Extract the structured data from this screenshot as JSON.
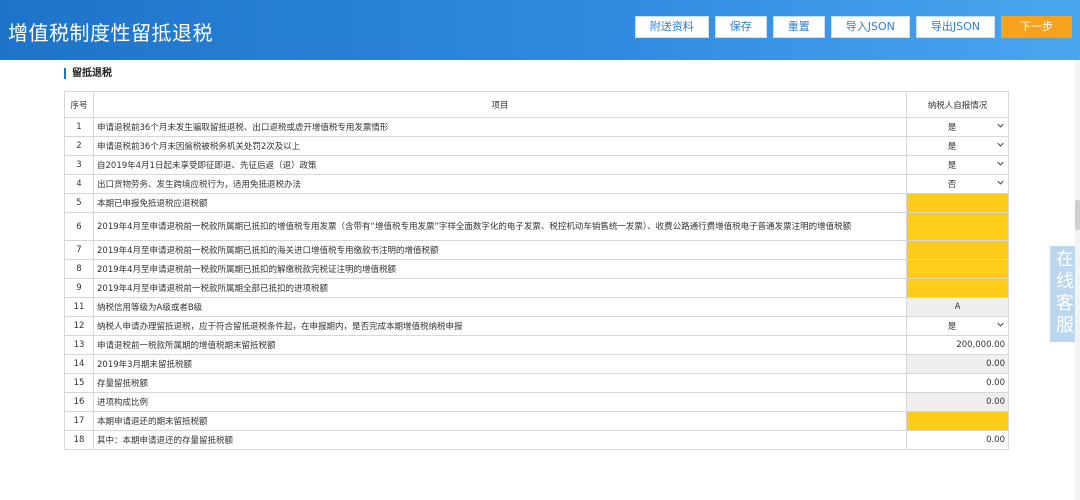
{
  "header": {
    "title": "增值税制度性留抵退税"
  },
  "toolbar": {
    "attachments_label": "附送资料",
    "save_label": "保存",
    "reset_label": "重置",
    "import_json_label": "导入JSON",
    "export_json_label": "导出JSON",
    "next_label": "下一步"
  },
  "colors": {
    "header_blue": "#1e73c8",
    "next_orange": "#f7a21c",
    "required_yellow": "#ffcc1a"
  },
  "section": {
    "title": "留抵退税"
  },
  "table": {
    "headers": {
      "no": "序号",
      "item": "项目",
      "value": "纳税人自报情况"
    },
    "rows": [
      {
        "no": "1",
        "item": "申请退税前36个月未发生骗取留抵退税、出口退税或虚开增值税专用发票情形",
        "value": "是",
        "type": "select"
      },
      {
        "no": "2",
        "item": "申请退税前36个月未因偷税被税务机关处罚2次及以上",
        "value": "是",
        "type": "select"
      },
      {
        "no": "3",
        "item": "自2019年4月1日起未享受即征即退、先征后返（退）政策",
        "value": "是",
        "type": "select"
      },
      {
        "no": "4",
        "item": "出口货物劳务、发生跨境应税行为，适用免抵退税办法",
        "value": "否",
        "type": "select"
      },
      {
        "no": "5",
        "item": "本期已申报免抵退税应退税额",
        "value": "",
        "type": "yellow"
      },
      {
        "no": "6",
        "item": "2019年4月至申请退税前一税款所属期已抵扣的增值税专用发票（含带有“增值税专用发票”字样全面数字化的电子发票、税控机动车销售统一发票）、收费公路通行费增值税电子普通发票注明的增值税额",
        "value": "",
        "type": "yellow",
        "tall": true
      },
      {
        "no": "7",
        "item": "2019年4月至申请退税前一税款所属期已抵扣的海关进口增值税专用缴款书注明的增值税额",
        "value": "",
        "type": "yellow"
      },
      {
        "no": "8",
        "item": "2019年4月至申请退税前一税款所属期已抵扣的解缴税款完税证注明的增值税额",
        "value": "",
        "type": "yellow"
      },
      {
        "no": "9",
        "item": "2019年4月至申请退税前一税款所属期全部已抵扣的进项税额",
        "value": "",
        "type": "yellow"
      },
      {
        "no": "11",
        "item": "纳税信用等级为A级或者B级",
        "value": "A",
        "type": "grey-bold"
      },
      {
        "no": "12",
        "item": "纳税人申请办理留抵退税，应于符合留抵退税条件起，在申报期内，是否完成本期增值税纳税申报",
        "value": "是",
        "type": "select"
      },
      {
        "no": "13",
        "item": "申请退税前一税款所属期的增值税期末留抵税额",
        "value": "200,000.00",
        "type": "input"
      },
      {
        "no": "14",
        "item": "2019年3月期末留抵税额",
        "value": "0.00",
        "type": "grey"
      },
      {
        "no": "15",
        "item": "存量留抵税额",
        "value": "0.00",
        "type": "input"
      },
      {
        "no": "16",
        "item": "进项构成比例",
        "value": "0.00",
        "type": "grey"
      },
      {
        "no": "17",
        "item": "本期申请退还的期末留抵税额",
        "value": "",
        "type": "yellow"
      },
      {
        "no": "18",
        "item": "其中：本期申请退还的存量留抵税额",
        "value": "0.00",
        "type": "input"
      }
    ]
  },
  "side_chat": {
    "label_chars": [
      "在",
      "线",
      "客",
      "服"
    ]
  }
}
